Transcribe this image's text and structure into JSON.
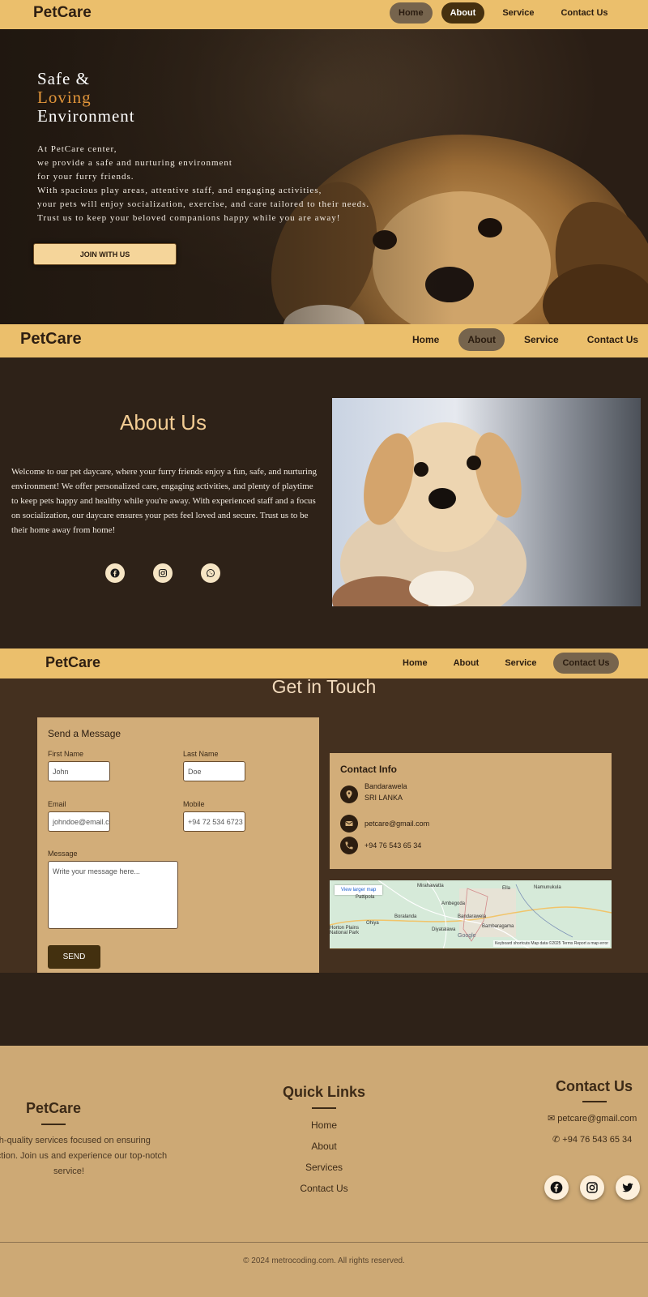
{
  "brand": "PetCare",
  "nav": {
    "home": "Home",
    "about": "About",
    "service": "Service",
    "contact": "Contact Us"
  },
  "hero": {
    "title_line1": "Safe &",
    "title_line2": "Loving",
    "title_line3": "Environment",
    "text": [
      "At PetCare center,",
      "we provide a safe and nurturing environment",
      "for your furry friends.",
      "With spacious play areas, attentive staff, and engaging activities,",
      "your pets will enjoy socialization, exercise, and care tailored to their needs.",
      "Trust us to keep your beloved companions happy while you are away!"
    ],
    "button": "JOIN WITH US"
  },
  "about": {
    "title": "About Us",
    "text": "Welcome to our pet daycare, where your furry friends enjoy a fun, safe, and nurturing environment! We offer personalized care, engaging activities, and plenty of playtime to keep pets happy and healthy while you're away. With experienced staff and a focus on socialization, our daycare ensures your pets feel loved and secure. Trust us to be their home away from home!",
    "socials": [
      "facebook-icon",
      "instagram-icon",
      "whatsapp-icon"
    ]
  },
  "contact": {
    "title": "Get in Touch",
    "form": {
      "header": "Send a Message",
      "first_name_label": "First Name",
      "first_name_placeholder": "John",
      "last_name_label": "Last Name",
      "last_name_placeholder": "Doe",
      "email_label": "Email",
      "email_placeholder": "johndoe@email.com",
      "mobile_label": "Mobile",
      "mobile_placeholder": "+94 72 534 6723",
      "message_label": "Message",
      "message_placeholder": "Write your message here...",
      "send": "SEND"
    },
    "info": {
      "header": "Contact Info",
      "address_line1": "Bandarawela",
      "address_line2": "SRI LANKA",
      "email": "petcare@gmail.com",
      "phone": "+94 76 543 65 34"
    },
    "map": {
      "button": "View larger map",
      "places": [
        "Mirahawatta",
        "Namunukula",
        "Ella",
        "Pattipola",
        "Ambegoda",
        "Boralanda",
        "Bandarawela",
        "Ohiya",
        "Horton Plains National Park",
        "Diyatalawa",
        "Bambaragama"
      ],
      "footer": "Keyboard shortcuts   Map data ©2025   Terms   Report a map error",
      "google": "Google"
    }
  },
  "footer": {
    "brand": "PetCare",
    "description": "high-quality services focused on ensuring satisfaction. Join us and experience our top-notch service!",
    "quick_links_title": "Quick Links",
    "links": [
      "Home",
      "About",
      "Services",
      "Contact Us"
    ],
    "contact_title": "Contact Us",
    "email": "petcare@gmail.com",
    "phone": "+94 76 543 65 34",
    "socials": [
      "facebook-icon",
      "instagram-icon",
      "twitter-icon"
    ],
    "copyright": "© 2024 metrocoding.com. All rights reserved."
  },
  "colors": {
    "nav_bg": "#ebbf6c",
    "dark_bg": "#2e2218",
    "accent": "#e1953a",
    "card": "#d2ad79",
    "footer": "#cda975"
  }
}
